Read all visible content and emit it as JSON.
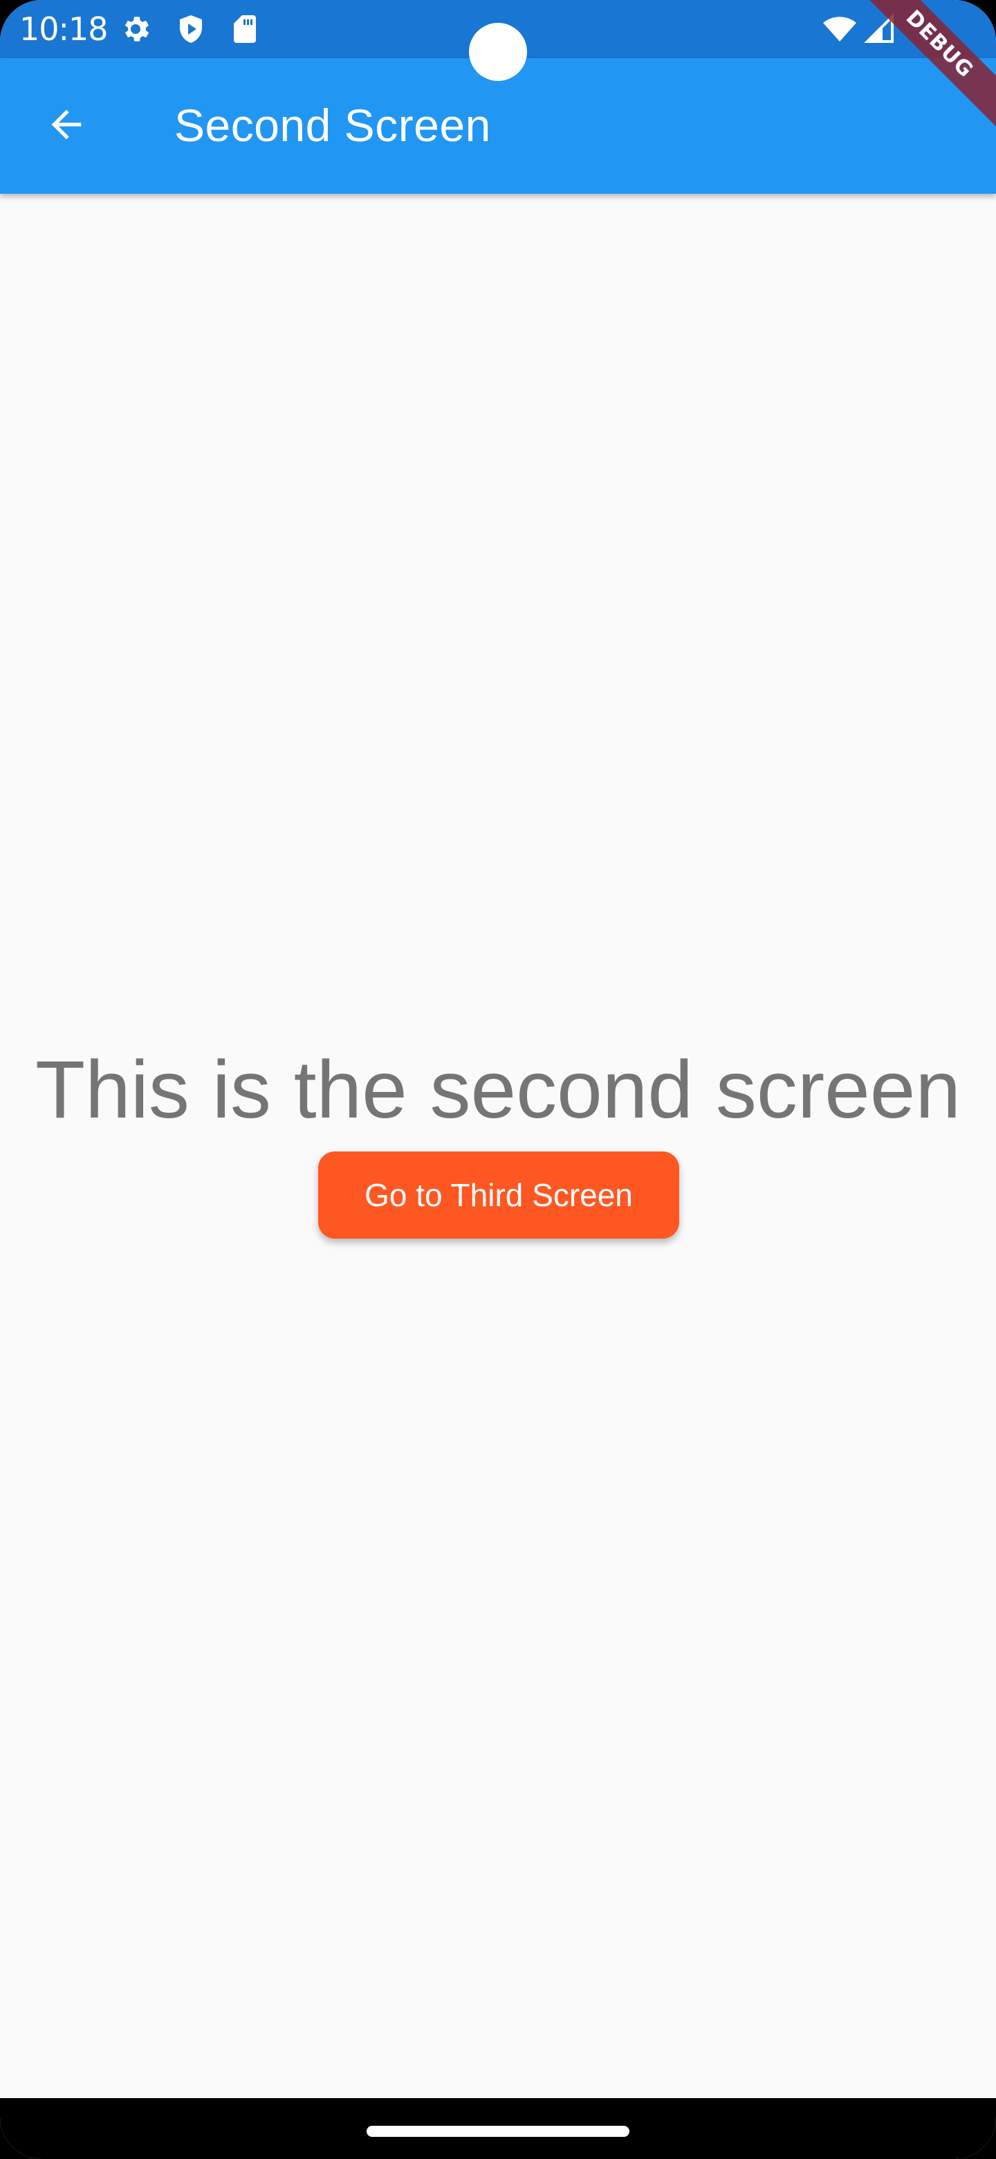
{
  "status_bar": {
    "time": "10:18",
    "icons": [
      "gear-icon",
      "shield-play-icon",
      "sd-card-icon",
      "wifi-icon",
      "signal-icon"
    ],
    "background": "#1976d2"
  },
  "app_bar": {
    "title": "Second Screen",
    "back_icon": "arrow-back-icon",
    "background": "#2196f3"
  },
  "debug_banner": {
    "label": "DEBUG"
  },
  "main": {
    "heading": "This is the second screen",
    "button_label": "Go to Third Screen",
    "button_color": "#ff5722",
    "background": "#fafafa"
  },
  "navigation_bar": {
    "home_indicator": "home-pill"
  }
}
